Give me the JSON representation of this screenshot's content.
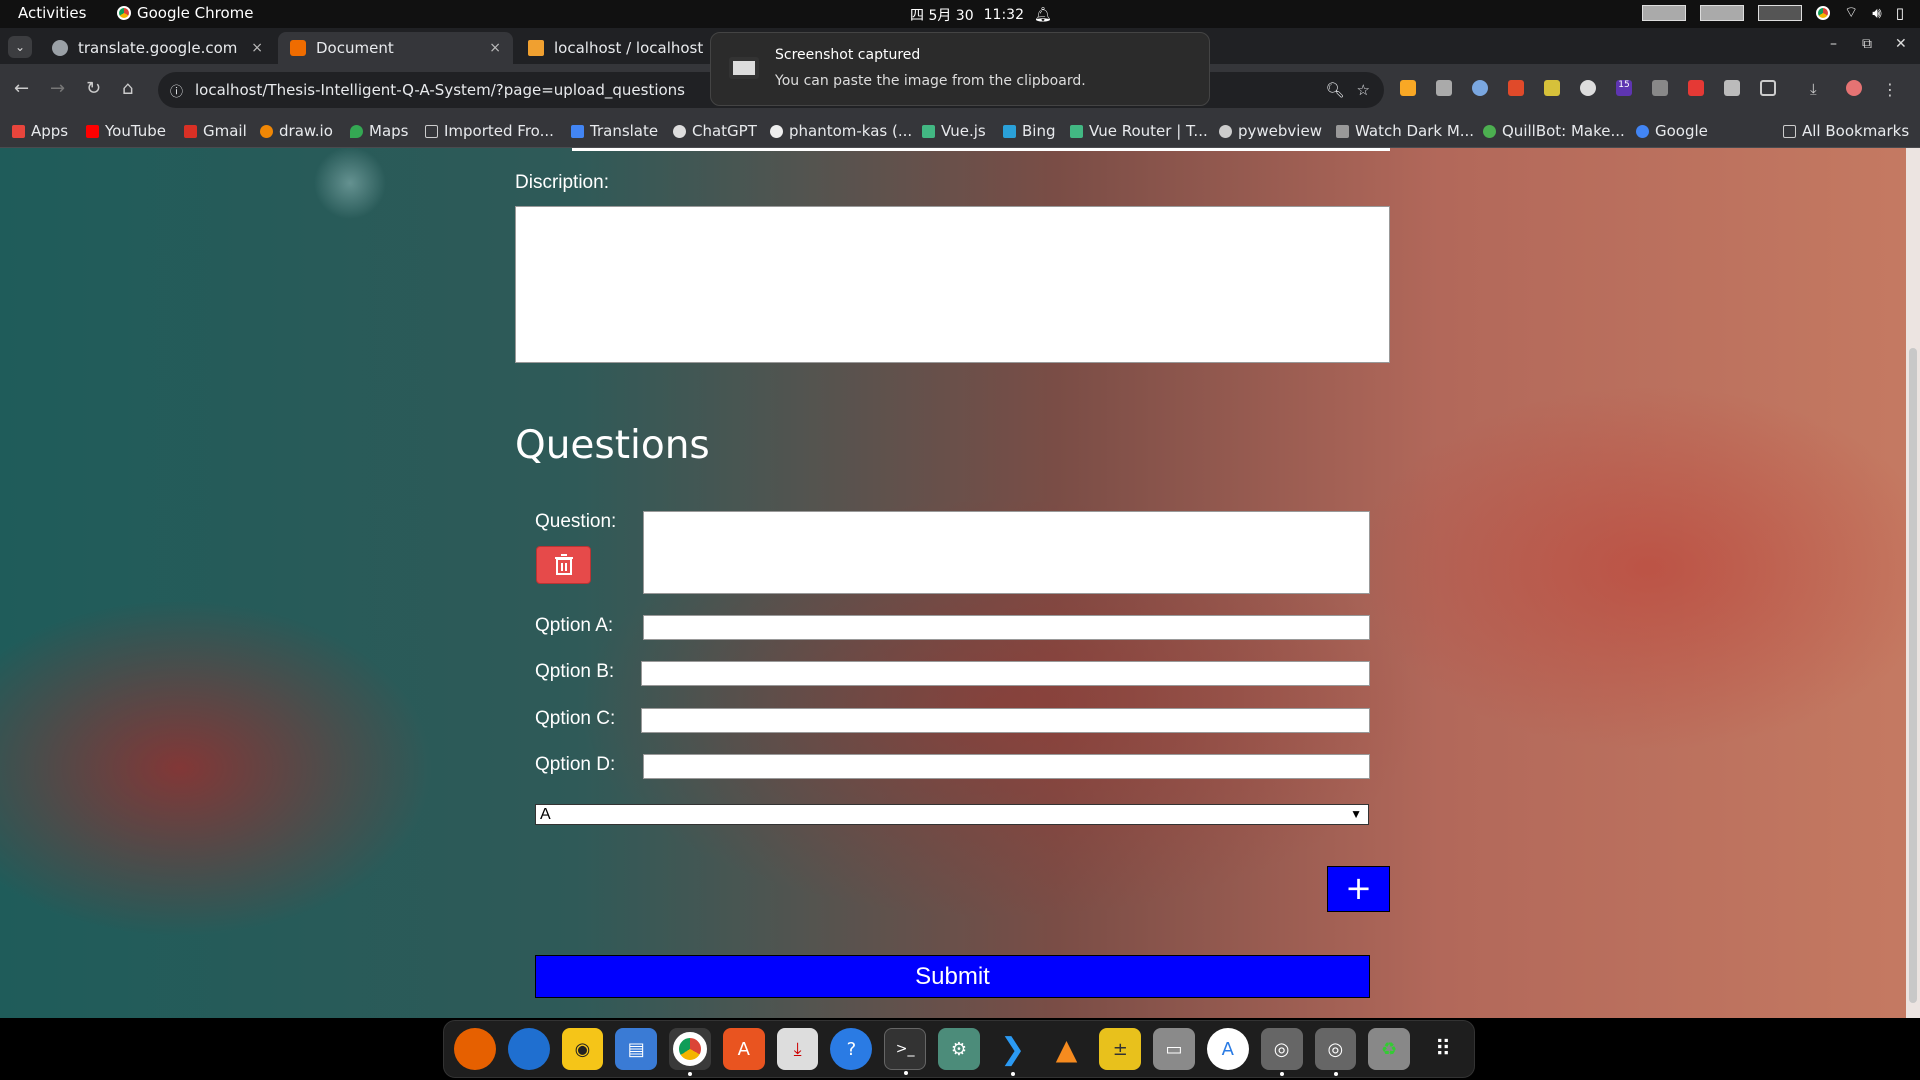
{
  "topbar": {
    "activities": "Activities",
    "app_name": "Google Chrome",
    "date": "四 5月 30",
    "time": "11:32"
  },
  "tabs": [
    {
      "title": "translate.google.com",
      "close": "×"
    },
    {
      "title": "Document",
      "close": "×",
      "active": true
    },
    {
      "title": "localhost / localhost / q"
    }
  ],
  "window_controls": {
    "minimize": "–",
    "maximize": "⧉",
    "close": "✕"
  },
  "toolbar": {
    "url": "localhost/Thesis-Intelligent-Q-A-System/?page=upload_questions",
    "ext_badge": "15"
  },
  "bookmarks": [
    "Apps",
    "YouTube",
    "Gmail",
    "draw.io",
    "Maps",
    "Imported Fro...",
    "Translate",
    "ChatGPT",
    "phantom-kas (...",
    "Vue.js",
    "Bing",
    "Vue Router | T...",
    "pywebview",
    "Watch Dark M...",
    "QuillBot: Make...",
    "Google"
  ],
  "all_bookmarks": "All Bookmarks",
  "notification": {
    "title": "Screenshot captured",
    "body": "You can paste the image from the clipboard."
  },
  "form": {
    "description_label": "Discription:",
    "questions_heading": "Questions",
    "question_label": "Question:",
    "option_a_label": "Qption A:",
    "option_b_label": "Qption B:",
    "option_c_label": "Qption C:",
    "option_d_label": "Qption D:",
    "answer_selected": "A",
    "add_label": "+",
    "submit_label": "Submit"
  },
  "colors": {
    "primary_button": "#0000ff",
    "delete_button": "#e64a4a"
  }
}
